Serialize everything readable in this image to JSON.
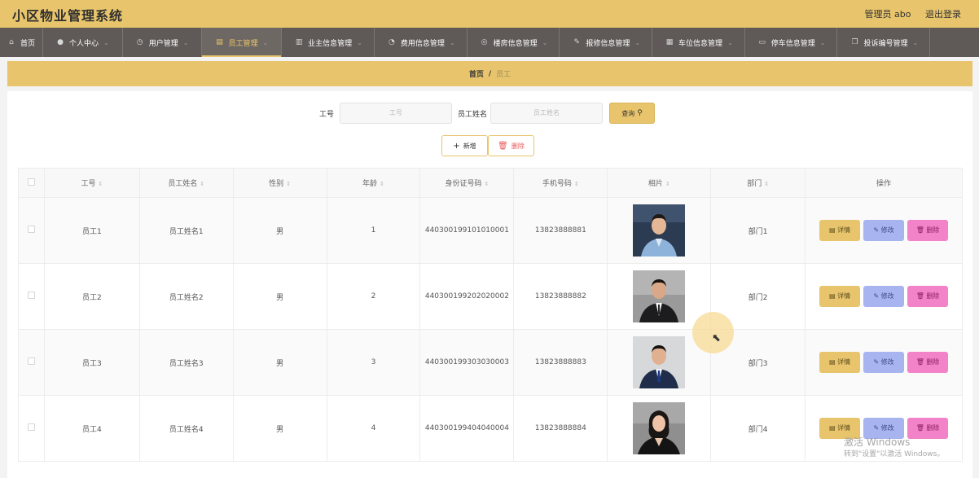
{
  "header": {
    "title": "小区物业管理系统",
    "user_label": "管理员 abo",
    "logout_label": "退出登录"
  },
  "nav": {
    "items": [
      {
        "label": "首页",
        "icon": "home-icon",
        "dropdown": false,
        "active": false
      },
      {
        "label": "个人中心",
        "icon": "user-icon",
        "dropdown": true,
        "active": false
      },
      {
        "label": "用户管理",
        "icon": "clock-icon",
        "dropdown": true,
        "active": false
      },
      {
        "label": "员工管理",
        "icon": "document-icon",
        "dropdown": true,
        "active": true
      },
      {
        "label": "业主信息管理",
        "icon": "chart-icon",
        "dropdown": true,
        "active": false
      },
      {
        "label": "费用信息管理",
        "icon": "gauge-icon",
        "dropdown": true,
        "active": false
      },
      {
        "label": "楼房信息管理",
        "icon": "compass-icon",
        "dropdown": true,
        "active": false
      },
      {
        "label": "报修信息管理",
        "icon": "brush-icon",
        "dropdown": true,
        "active": false
      },
      {
        "label": "车位信息管理",
        "icon": "grid-icon",
        "dropdown": true,
        "active": false
      },
      {
        "label": "停车信息管理",
        "icon": "monitor-icon",
        "dropdown": true,
        "active": false
      },
      {
        "label": "投诉编号管理",
        "icon": "copy-icon",
        "dropdown": true,
        "active": false
      }
    ]
  },
  "breadcrumb": {
    "home": "首页",
    "separator": "/",
    "current": "员工"
  },
  "search": {
    "field1_label": "工号",
    "field1_placeholder": "工号",
    "field2_label": "员工姓名",
    "field2_placeholder": "员工姓名",
    "query_label": "查询"
  },
  "actions": {
    "add_label": "新增",
    "delete_label": "删除"
  },
  "table": {
    "headers": [
      "工号",
      "员工姓名",
      "性别",
      "年龄",
      "身份证号码",
      "手机号码",
      "相片",
      "部门",
      "操作"
    ],
    "rows": [
      {
        "id": "员工1",
        "name": "员工姓名1",
        "gender": "男",
        "age": "1",
        "idcard": "440300199101010001",
        "phone": "13823888881",
        "dept": "部门1"
      },
      {
        "id": "员工2",
        "name": "员工姓名2",
        "gender": "男",
        "age": "2",
        "idcard": "440300199202020002",
        "phone": "13823888882",
        "dept": "部门2"
      },
      {
        "id": "员工3",
        "name": "员工姓名3",
        "gender": "男",
        "age": "3",
        "idcard": "440300199303030003",
        "phone": "13823888883",
        "dept": "部门3"
      },
      {
        "id": "员工4",
        "name": "员工姓名4",
        "gender": "男",
        "age": "4",
        "idcard": "440300199404040004",
        "phone": "13823888884",
        "dept": "部门4"
      }
    ],
    "row_actions": {
      "detail": "详情",
      "edit": "修改",
      "delete": "删除"
    }
  },
  "watermark": {
    "line1": "激活 Windows",
    "line2": "转到\"设置\"以激活 Windows。"
  },
  "colors": {
    "accent": "#e8c56c",
    "nav_bg": "#5f5a57",
    "edit_btn": "#a7b4ef",
    "delete_btn": "#f283c8"
  }
}
